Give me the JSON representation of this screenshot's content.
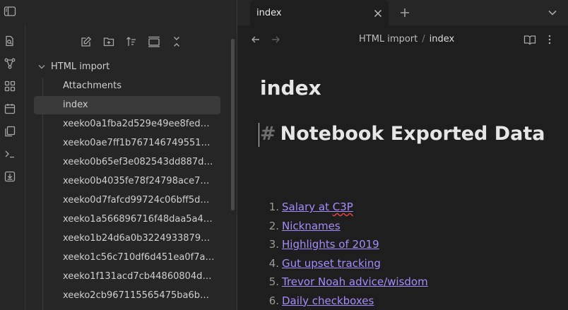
{
  "ribbon": {
    "icons": [
      "open-quick-switcher-icon",
      "graph-view-icon",
      "canvas-icon",
      "daily-notes-icon",
      "templates-icon",
      "command-palette-icon",
      "importer-icon"
    ]
  },
  "topbar": {
    "buttons": [
      "toggle-sidebar-icon",
      "files-icon",
      "search-icon",
      "bookmarks-icon"
    ]
  },
  "filebar": {
    "buttons": [
      "new-note-icon",
      "new-folder-icon",
      "sort-icon",
      "auto-reveal-icon",
      "collapse-all-icon"
    ]
  },
  "tree": {
    "folder": "HTML import",
    "attachments": "Attachments",
    "items": [
      "index",
      "xeeko0a1fba2d529e49ee8fed23...",
      "xeeko0ae7ff1b767146749551ff6...",
      "xeeko0b65ef3e082543dd887d9...",
      "xeeko0b4035fe78f24798ace779...",
      "xeeko0d7fafcd99724c06bff5d79...",
      "xeeko1a566896716f48daa5a41f...",
      "xeeko1b24d6a0b322493387902...",
      "xeeko1c56c710df6d451ea0f7a07...",
      "xeeko1f131acd7cb44860804d5a...",
      "xeeko2cb967115565475ba6b0fb..."
    ]
  },
  "tab": {
    "title": "index"
  },
  "breadcrumb": {
    "folder": "HTML import",
    "separator": "/",
    "current": "index"
  },
  "note": {
    "inline_title": "index",
    "heading_hash": "#",
    "heading_text": "Notebook Exported Data",
    "list": [
      {
        "num": "1.",
        "pre": "Salary at ",
        "misspelled": "C3P",
        "post": ""
      },
      {
        "num": "2.",
        "pre": "Nicknames",
        "misspelled": "",
        "post": ""
      },
      {
        "num": "3.",
        "pre": "Highlights of 2019",
        "misspelled": "",
        "post": ""
      },
      {
        "num": "4.",
        "pre": "Gut upset tracking",
        "misspelled": "",
        "post": ""
      },
      {
        "num": "5.",
        "pre": "Trevor Noah advice/wisdom",
        "misspelled": "",
        "post": ""
      },
      {
        "num": "6.",
        "pre": "Daily checkboxes",
        "misspelled": "",
        "post": ""
      }
    ]
  },
  "colors": {
    "background": "#1e1e1e",
    "sidebar": "#262626",
    "link": "#a78bfa",
    "spellcheck": "#e04444"
  }
}
